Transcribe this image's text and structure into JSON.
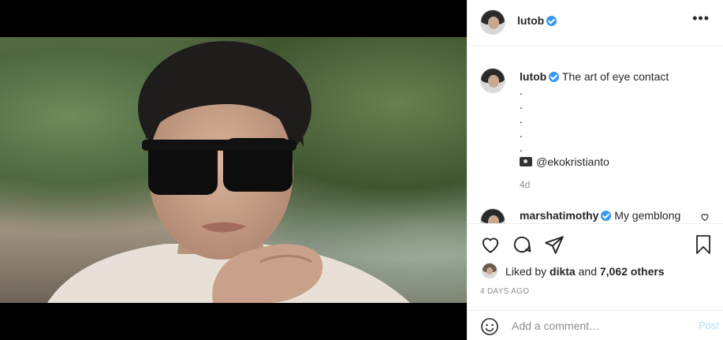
{
  "header": {
    "username": "lutob",
    "more_glyph": "•••"
  },
  "caption": {
    "username": "lutob",
    "text": "The art of eye contact",
    "dots": [
      ".",
      ".",
      ".",
      ".",
      "."
    ],
    "credit_icon": "camera-icon",
    "credit_handle": "@ekokristianto",
    "time": "4d"
  },
  "reply": {
    "username": "marshatimothy",
    "text": "My gemblong"
  },
  "likes": {
    "prefix": "Liked by",
    "user": "dikta",
    "joiner": "and",
    "others": "7,062 others"
  },
  "posted_ago": "4 DAYS AGO",
  "comment_box": {
    "placeholder": "Add a comment…",
    "post_label": "Post"
  },
  "colors": {
    "verified": "#3897f0",
    "post_disabled": "#b2dffc",
    "muted": "#8e8e8e"
  }
}
